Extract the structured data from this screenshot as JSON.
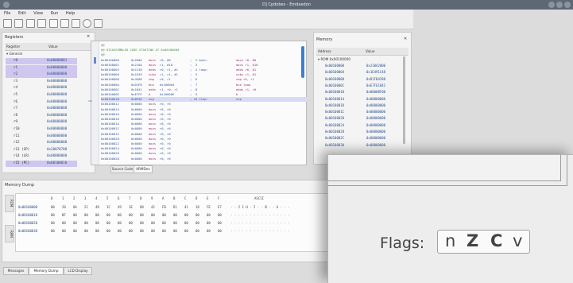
{
  "window": {
    "title": "D] Cpdobes - Emdaedon"
  },
  "menu": [
    "File",
    "Edit",
    "View",
    "Run",
    "Help"
  ],
  "registers": {
    "title": "Registers",
    "cols": [
      "Register",
      "Value"
    ],
    "group": "General",
    "rows": [
      {
        "n": "r0",
        "v": "0x00000001",
        "hl": true
      },
      {
        "n": "r1",
        "v": "0x00000000",
        "hl": true
      },
      {
        "n": "r2",
        "v": "0x00000000",
        "hl": true
      },
      {
        "n": "r3",
        "v": "0x00000000"
      },
      {
        "n": "r4",
        "v": "0x00000000"
      },
      {
        "n": "r5",
        "v": "0x00000000"
      },
      {
        "n": "r6",
        "v": "0x00000000"
      },
      {
        "n": "r7",
        "v": "0x00000000"
      },
      {
        "n": "r8",
        "v": "0x00000000"
      },
      {
        "n": "r9",
        "v": "0x00000000"
      },
      {
        "n": "r10",
        "v": "0x00000000"
      },
      {
        "n": "r11",
        "v": "0x00000000"
      },
      {
        "n": "r12",
        "v": "0x00000000"
      },
      {
        "n": "r13 (SP)",
        "v": "0x20070780"
      },
      {
        "n": "r14 (LR)",
        "v": "0x00000000"
      },
      {
        "n": "r15 (PC)",
        "v": "0x00100010",
        "hl": true
      }
    ]
  },
  "code": {
    "header": [
      "@@",
      "@@ DISASSEMBLED CODE STARTING AT 0x00100000",
      "@@"
    ],
    "lines": [
      {
        "a": "0x00100000",
        "op": "0x2000",
        "m": "movs",
        "args": "r0, #0",
        "c": ";  2 main:",
        "r": "movs r0, #0"
      },
      {
        "a": "0x00100002",
        "op": "0x210A",
        "m": "movs",
        "args": "r1, #10",
        "c": ";  3",
        "r": "movs r1, #10"
      },
      {
        "a": "0x00100004",
        "op": "0x1C48",
        "m": "adds",
        "args": "r0, r1, #1",
        "c": ";  4 loop:",
        "r": "adds r0, #1"
      },
      {
        "a": "0x00100006",
        "op": "0x1E49",
        "m": "subs",
        "args": "r1, r1, #1",
        "c": ";  5",
        "r": "subs r1, #1"
      },
      {
        "a": "0x00100008",
        "op": "0x4288",
        "m": "cmp",
        "args": "r0, r1",
        "c": ";  6",
        "r": "cmp r0, r1"
      },
      {
        "a": "0x0010000A",
        "op": "0xD1FB",
        "m": "bne",
        "args": "0x100004",
        "c": ";  7",
        "r": "bne loop"
      },
      {
        "a": "0x0010000C",
        "op": "0x1841",
        "m": "adds",
        "args": "r1, r0, r1",
        "c": ";  8",
        "r": "adds r1, r0"
      },
      {
        "a": "0x0010000E",
        "op": "0xE7FE",
        "m": "b",
        "args": "0x10000E",
        "c": ";  9",
        "r": "b ."
      },
      {
        "a": "0x00100010",
        "op": "0xBF00",
        "m": "nop",
        "args": "",
        "c": "; 10 stop:",
        "r": "nop",
        "cur": true
      },
      {
        "a": "0x00100012",
        "op": "0x0000",
        "m": "movs",
        "args": "r0, r0",
        "c": "",
        "r": ""
      },
      {
        "a": "0x00100014",
        "op": "0x0000",
        "m": "movs",
        "args": "r0, r0",
        "c": "",
        "r": ""
      },
      {
        "a": "0x00100016",
        "op": "0x0000",
        "m": "movs",
        "args": "r0, r0",
        "c": "",
        "r": ""
      },
      {
        "a": "0x00100018",
        "op": "0x0000",
        "m": "movs",
        "args": "r0, r0",
        "c": "",
        "r": ""
      },
      {
        "a": "0x0010001A",
        "op": "0x0000",
        "m": "movs",
        "args": "r0, r0",
        "c": "",
        "r": ""
      },
      {
        "a": "0x0010001C",
        "op": "0x0000",
        "m": "movs",
        "args": "r0, r0",
        "c": "",
        "r": ""
      },
      {
        "a": "0x0010001E",
        "op": "0x0000",
        "m": "movs",
        "args": "r0, r0",
        "c": "",
        "r": ""
      },
      {
        "a": "0x00100020",
        "op": "0x0000",
        "m": "movs",
        "args": "r0, r0",
        "c": "",
        "r": ""
      },
      {
        "a": "0x00100022",
        "op": "0x0000",
        "m": "movs",
        "args": "r0, r0",
        "c": "",
        "r": ""
      },
      {
        "a": "0x00100024",
        "op": "0x0000",
        "m": "movs",
        "args": "r0, r0",
        "c": "",
        "r": ""
      },
      {
        "a": "0x00100026",
        "op": "0x0000",
        "m": "movs",
        "args": "r0, r0",
        "c": "",
        "r": ""
      },
      {
        "a": "0x00100028",
        "op": "0x0000",
        "m": "movs",
        "args": "r0, r0",
        "c": "",
        "r": ""
      }
    ],
    "tabs": [
      "Source Code",
      "ARMDev"
    ]
  },
  "memory": {
    "title": "Memory",
    "cols": [
      "Address",
      "Value"
    ],
    "group": "ROM 0x00100000",
    "rows": [
      {
        "a": "0x00100000",
        "v": "0x210A2000"
      },
      {
        "a": "0x00100004",
        "v": "0x1E491C48"
      },
      {
        "a": "0x00100008",
        "v": "0xD1FB4288"
      },
      {
        "a": "0x0010000C",
        "v": "0xE7FE1841"
      },
      {
        "a": "0x00100010",
        "v": "0x0000BF00"
      },
      {
        "a": "0x00100014",
        "v": "0x00000000"
      },
      {
        "a": "0x00100018",
        "v": "0x00000000"
      },
      {
        "a": "0x0010001C",
        "v": "0x00000000"
      },
      {
        "a": "0x00100020",
        "v": "0x00000000"
      },
      {
        "a": "0x00100024",
        "v": "0x00000000"
      },
      {
        "a": "0x00100028",
        "v": "0x00000000"
      },
      {
        "a": "0x0010002C",
        "v": "0x00000000"
      },
      {
        "a": "0x00100030",
        "v": "0x00000000"
      }
    ]
  },
  "dump": {
    "title": "Memory Dump",
    "side": [
      "ROM",
      "RAM"
    ],
    "cols": [
      "0",
      "1",
      "2",
      "3",
      "4",
      "5",
      "6",
      "7",
      "8",
      "9",
      "A",
      "B",
      "C",
      "D",
      "E",
      "F",
      "ASCII"
    ],
    "rows": [
      {
        "a": "0x00100000",
        "b": [
          "00",
          "20",
          "0A",
          "21",
          "48",
          "1C",
          "49",
          "1E",
          "88",
          "42",
          "FB",
          "D1",
          "41",
          "18",
          "FE",
          "E7"
        ],
        "s": "· · 2 1 H · I · · B · · A · · ·"
      },
      {
        "a": "0x00100010",
        "b": [
          "00",
          "BF",
          "00",
          "00",
          "00",
          "00",
          "00",
          "00",
          "00",
          "00",
          "00",
          "00",
          "00",
          "00",
          "00",
          "00"
        ],
        "s": "· · · · · · · · · · · · · · · ·"
      },
      {
        "a": "0x00100020",
        "b": [
          "00",
          "00",
          "00",
          "00",
          "00",
          "00",
          "00",
          "00",
          "00",
          "00",
          "00",
          "00",
          "00",
          "00",
          "00",
          "00"
        ],
        "s": "· · · · · · · · · · · · · · · ·"
      },
      {
        "a": "0x00100030",
        "b": [
          "00",
          "00",
          "00",
          "00",
          "00",
          "00",
          "00",
          "00",
          "00",
          "00",
          "00",
          "00",
          "00",
          "00",
          "00",
          "00"
        ],
        "s": "· · · · · · · · · · · · · · · ·"
      }
    ]
  },
  "bottom_tabs": [
    "Messages",
    "Memory Dump",
    "LCD Display"
  ],
  "flags": {
    "label": "Flags:",
    "n": "n",
    "z": "Z",
    "c": "C",
    "v": "v"
  }
}
